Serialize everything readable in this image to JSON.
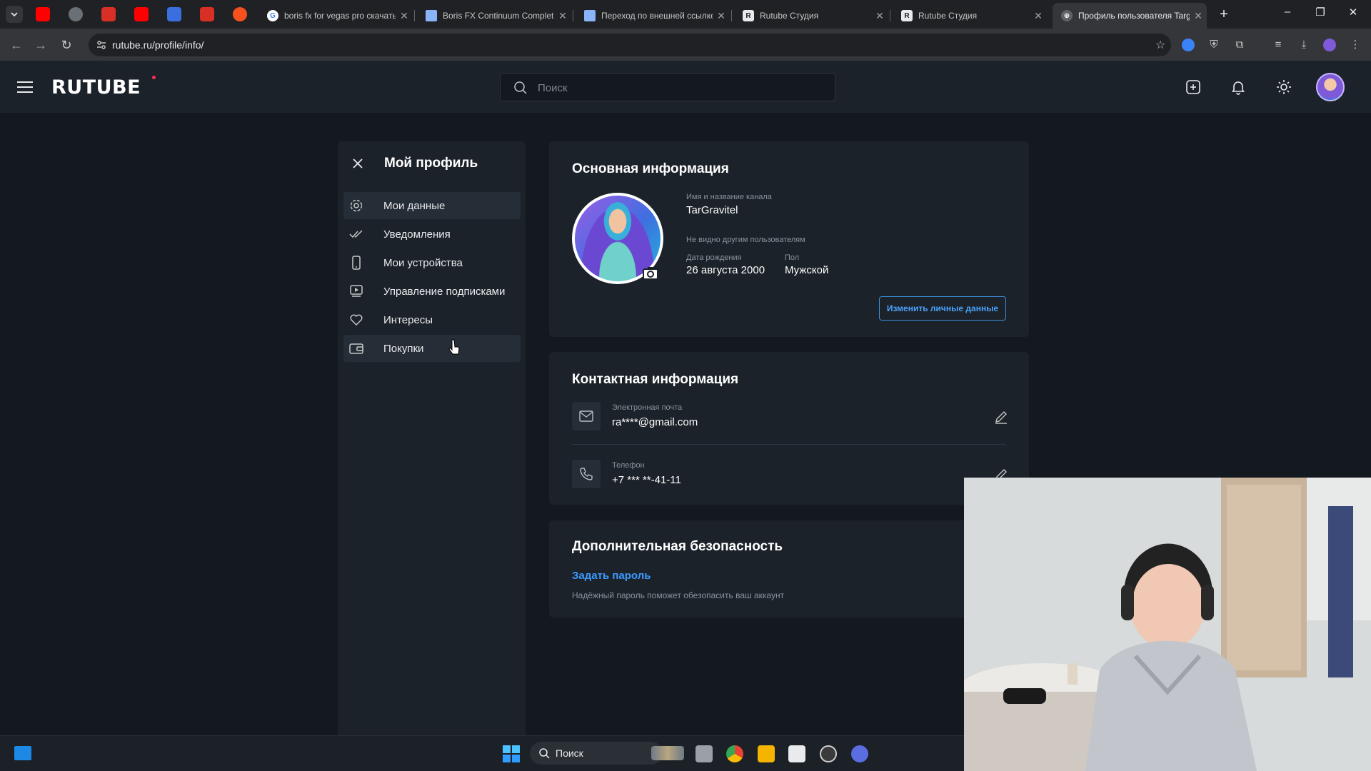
{
  "browser": {
    "tabs": [
      {
        "title": "boris fx for vegas pro скачать",
        "fav": "G"
      },
      {
        "title": "Boris FX Continuum Complete",
        "fav": ""
      },
      {
        "title": "Переход по внешней ссылке",
        "fav": ""
      },
      {
        "title": "Rutube Студия",
        "fav": "R"
      },
      {
        "title": "Rutube Студия",
        "fav": "R"
      },
      {
        "title": "Профиль пользователя TargGravitel",
        "fav": "⊕"
      }
    ],
    "url": "rutube.ru/profile/info/"
  },
  "header": {
    "logo": "RUTUBE",
    "search_placeholder": "Поиск"
  },
  "sidebar": {
    "title": "Мой профиль",
    "items": [
      {
        "label": "Мои данные",
        "icon": "gear-icon"
      },
      {
        "label": "Уведомления",
        "icon": "double-check-icon"
      },
      {
        "label": "Мои устройства",
        "icon": "phone-icon"
      },
      {
        "label": "Управление подписками",
        "icon": "subscription-icon"
      },
      {
        "label": "Интересы",
        "icon": "heart-icon"
      },
      {
        "label": "Покупки",
        "icon": "wallet-icon"
      }
    ]
  },
  "basic": {
    "title": "Основная информация",
    "name_caption": "Имя и название канала",
    "name_value": "TarGravitel",
    "hidden_note": "Не видно другим пользователям",
    "birth_caption": "Дата рождения",
    "birth_value": "26 августа 2000",
    "gender_caption": "Пол",
    "gender_value": "Мужской",
    "edit_button": "Изменить личные данные"
  },
  "contact": {
    "title": "Контактная информация",
    "email_caption": "Электронная почта",
    "email_value": "ra****@gmail.com",
    "phone_caption": "Телефон",
    "phone_value": "+7 *** **-41-11"
  },
  "security": {
    "title": "Дополнительная безопасность",
    "set_password": "Задать пароль",
    "hint": "Надёжный пароль поможет обезопасить ваш аккаунт"
  },
  "taskbar": {
    "search_label": "Поиск"
  },
  "colors": {
    "accent": "#3b9aff",
    "bg": "#14191f",
    "card": "#1c2229",
    "logo_dot": "#ff2d55"
  }
}
